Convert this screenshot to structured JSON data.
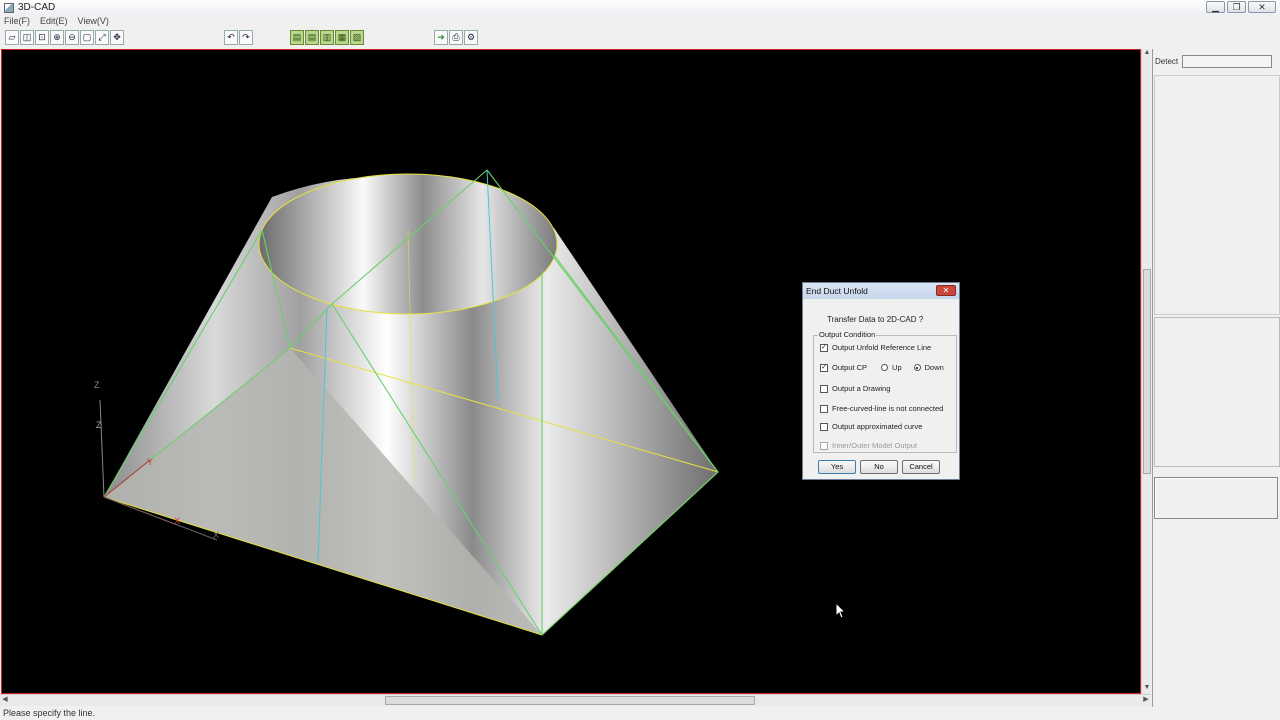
{
  "window": {
    "title": "3D-CAD",
    "controls": {
      "minimize": "▁",
      "maximize": "❐",
      "close": "✕"
    }
  },
  "menu": [
    "File(F)",
    "Edit(E)",
    "View(V)"
  ],
  "toolbar": {
    "view_buttons": [
      "select-icon",
      "frame-icon",
      "zoom-window-icon",
      "zoom-in-icon",
      "zoom-out-icon",
      "fit-icon",
      "rotate-icon",
      "pan-icon"
    ],
    "undo_icon": "undo-icon",
    "redo_icon": "redo-icon",
    "model_buttons": [
      "model-1-icon",
      "model-2-icon",
      "model-3-icon",
      "model-4-icon",
      "model-5-icon"
    ],
    "output_buttons": [
      "export-icon",
      "print-icon",
      "settings-icon"
    ]
  },
  "viewport": {
    "background": "#000000",
    "axes": [
      "Z",
      "Z",
      "Y",
      "X",
      "X"
    ]
  },
  "right_panel": {
    "detect_label": "Detect",
    "detect_value": ""
  },
  "dialog": {
    "title": "End Duct Unfold",
    "close": "✕",
    "message": "Transfer Data to 2D-CAD ?",
    "group_label": "Output Condition",
    "options": [
      {
        "label": "Output Unfold Reference Line",
        "checked": true,
        "enabled": true
      },
      {
        "label": "Output CP",
        "checked": true,
        "enabled": true
      },
      {
        "label": "Output a Drawing",
        "checked": false,
        "enabled": true
      },
      {
        "label": "Free-curved-line is not connected",
        "checked": false,
        "enabled": true
      },
      {
        "label": "Output approximated curve",
        "checked": false,
        "enabled": true
      },
      {
        "label": "Inner/Outer Model Output",
        "checked": false,
        "enabled": false
      }
    ],
    "radio_up": "Up",
    "radio_down": "Down",
    "radio_selected": "Down",
    "buttons": {
      "yes": "Yes",
      "no": "No",
      "cancel": "Cancel"
    }
  },
  "status": {
    "text": "Please specify the line."
  },
  "colors": {
    "frame_border": "#cc2222",
    "wire_green": "#6ad06a",
    "wire_yellow": "#e6e040",
    "wire_cyan": "#4fc3d9"
  }
}
